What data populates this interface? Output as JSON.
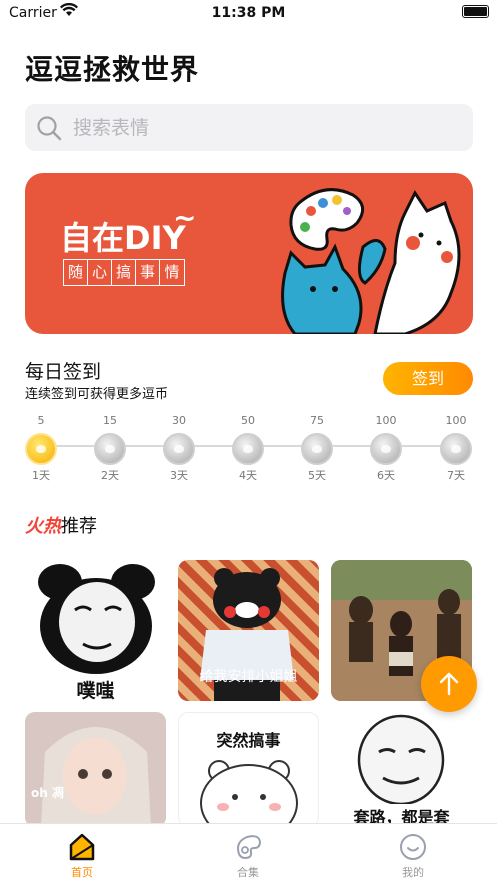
{
  "status_bar": {
    "carrier": "Carrier",
    "time": "11:38 PM"
  },
  "header": {
    "title": "逗逗拯救世界"
  },
  "search": {
    "placeholder": "搜索表情"
  },
  "banner": {
    "title": "自在DIY",
    "tilde": "~",
    "subtitle_chars": [
      "随",
      "心",
      "搞",
      "事",
      "情"
    ]
  },
  "checkin": {
    "title": "每日签到",
    "subtitle": "连续签到可获得更多逗币",
    "button_label": "签到",
    "days": [
      {
        "amount": "5",
        "label": "1天",
        "active": true
      },
      {
        "amount": "15",
        "label": "2天",
        "active": false
      },
      {
        "amount": "30",
        "label": "3天",
        "active": false
      },
      {
        "amount": "50",
        "label": "4天",
        "active": false
      },
      {
        "amount": "75",
        "label": "5天",
        "active": false
      },
      {
        "amount": "100",
        "label": "6天",
        "active": false
      },
      {
        "amount": "100",
        "label": "7天",
        "active": false
      }
    ]
  },
  "hot": {
    "highlight": "火热",
    "rest": "推荐"
  },
  "stickers": [
    {
      "caption": "噗嗤"
    },
    {
      "caption": "给我安排小姐姐"
    },
    {
      "caption": ""
    },
    {
      "caption": "oh 凋"
    },
    {
      "caption": "突然搞事"
    },
    {
      "caption": "套路，都是套"
    }
  ],
  "tabbar": [
    {
      "label": "首页",
      "active": true
    },
    {
      "label": "合集",
      "active": false
    },
    {
      "label": "我的",
      "active": false
    }
  ],
  "colors": {
    "accent": "#ff9a00",
    "banner": "#e8573b",
    "hot": "#f44336"
  }
}
